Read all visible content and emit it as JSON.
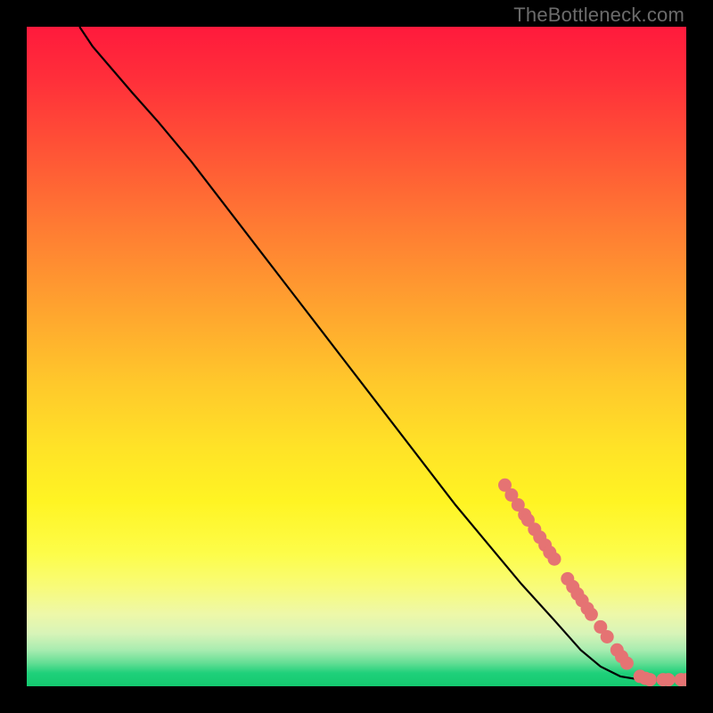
{
  "watermark": "TheBottleneck.com",
  "chart_data": {
    "type": "line",
    "title": "",
    "xlabel": "",
    "ylabel": "",
    "xlim": [
      0,
      100
    ],
    "ylim": [
      0,
      100
    ],
    "grid": false,
    "curve_description": "Monotone decreasing curve. Starts near top-left at roughly (8,100), sweeps down as a near-straight diagonal through the middle, then flattens near the bottom around y≈1 from x≈85 to x=100.",
    "curve_points_xy_percent": [
      [
        8,
        100
      ],
      [
        10,
        97
      ],
      [
        13,
        93.5
      ],
      [
        16,
        90
      ],
      [
        20,
        85.5
      ],
      [
        25,
        79.5
      ],
      [
        30,
        73
      ],
      [
        35,
        66.5
      ],
      [
        40,
        60
      ],
      [
        45,
        53.5
      ],
      [
        50,
        47
      ],
      [
        55,
        40.5
      ],
      [
        60,
        34
      ],
      [
        65,
        27.5
      ],
      [
        70,
        21.5
      ],
      [
        75,
        15.5
      ],
      [
        80,
        10
      ],
      [
        84,
        5.5
      ],
      [
        87,
        3
      ],
      [
        90,
        1.5
      ],
      [
        93,
        1
      ],
      [
        96,
        1
      ],
      [
        100,
        1
      ]
    ],
    "scatter_series": {
      "name": "markers",
      "color": "#e57373",
      "points_xy_percent": [
        [
          72.5,
          30.5
        ],
        [
          73.5,
          29
        ],
        [
          74.5,
          27.5
        ],
        [
          75.5,
          26
        ],
        [
          76,
          25.2
        ],
        [
          77,
          23.8
        ],
        [
          77.8,
          22.6
        ],
        [
          78.6,
          21.4
        ],
        [
          79.3,
          20.3
        ],
        [
          80,
          19.3
        ],
        [
          82,
          16.3
        ],
        [
          82.8,
          15.1
        ],
        [
          83.5,
          14
        ],
        [
          84.2,
          13
        ],
        [
          85,
          11.8
        ],
        [
          85.6,
          10.9
        ],
        [
          87,
          9
        ],
        [
          88,
          7.5
        ],
        [
          89.5,
          5.5
        ],
        [
          90.2,
          4.5
        ],
        [
          91,
          3.5
        ],
        [
          93,
          1.5
        ],
        [
          93.8,
          1.2
        ],
        [
          94.5,
          1
        ],
        [
          96.5,
          1
        ],
        [
          97.3,
          1
        ],
        [
          99.2,
          1
        ],
        [
          100,
          1
        ]
      ]
    }
  }
}
